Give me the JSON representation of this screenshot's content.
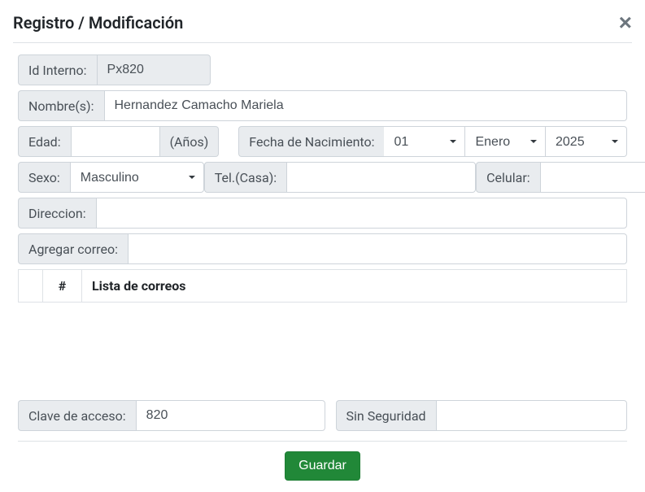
{
  "modal": {
    "title": "Registro / Modificación"
  },
  "labels": {
    "id_interno": "Id Interno:",
    "nombres": "Nombre(s):",
    "edad": "Edad:",
    "anos": "(Años)",
    "fecha_nacimiento": "Fecha de Nacimiento:",
    "sexo": "Sexo:",
    "tel_casa": "Tel.(Casa):",
    "celular": "Celular:",
    "direccion": "Direccion:",
    "agregar_correo": "Agregar correo:",
    "clave_acceso": "Clave de acceso:",
    "sin_seguridad": "Sin Seguridad"
  },
  "values": {
    "id_interno": "Px820",
    "nombres": "Hernandez Camacho Mariela",
    "edad": "",
    "dia": "01",
    "mes": "Enero",
    "anio": "2025",
    "sexo": "Masculino",
    "tel_casa": "",
    "celular": "",
    "direccion": "",
    "correo": "",
    "clave_acceso": "820",
    "seguridad_val": ""
  },
  "table": {
    "col_num": "#",
    "col_lista": "Lista de correos"
  },
  "buttons": {
    "guardar": "Guardar"
  }
}
